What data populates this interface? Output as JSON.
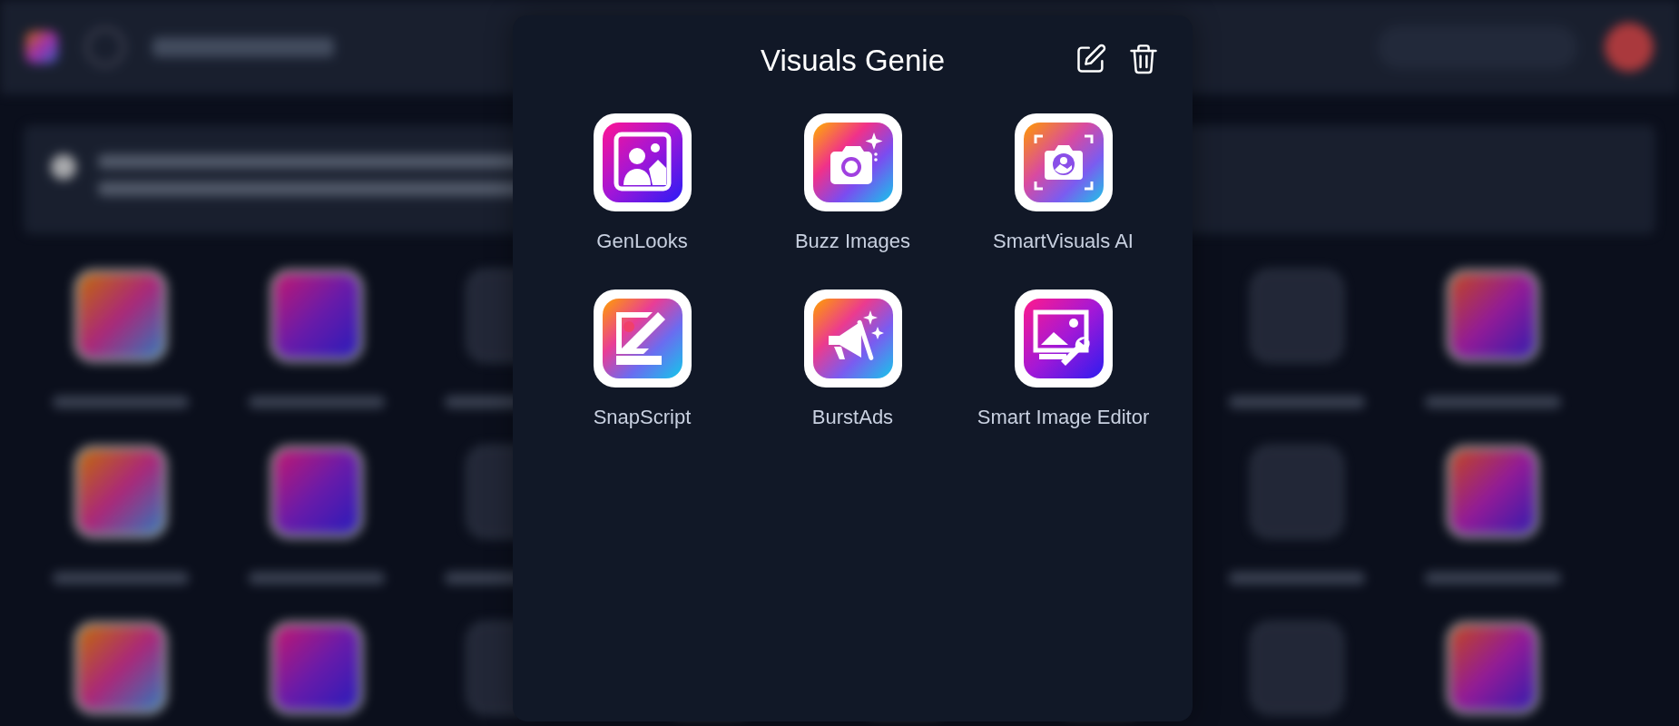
{
  "modal": {
    "title": "Visuals Genie",
    "actions": [
      {
        "kind": "edit"
      },
      {
        "kind": "delete"
      }
    ],
    "apps": [
      {
        "label": "GenLooks",
        "kind": "portrait"
      },
      {
        "label": "Buzz Images",
        "kind": "camera-sparkle"
      },
      {
        "label": "SmartVisuals AI",
        "kind": "camera-scan"
      },
      {
        "label": "SnapScript",
        "kind": "image-pencil"
      },
      {
        "label": "BurstAds",
        "kind": "megaphone"
      },
      {
        "label": "Smart Image Editor",
        "kind": "image-wrench"
      }
    ]
  }
}
